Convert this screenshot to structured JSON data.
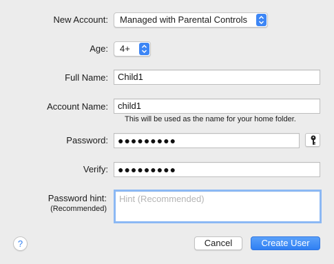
{
  "form": {
    "new_account": {
      "label": "New Account:",
      "value": "Managed with Parental Controls"
    },
    "age": {
      "label": "Age:",
      "value": "4+"
    },
    "full_name": {
      "label": "Full Name:",
      "value": "Child1"
    },
    "account_name": {
      "label": "Account Name:",
      "value": "child1",
      "note": "This will be used as the name for your home folder."
    },
    "password": {
      "label": "Password:",
      "value": "●●●●●●●●●"
    },
    "verify": {
      "label": "Verify:",
      "value": "●●●●●●●●●"
    },
    "password_hint": {
      "label": "Password hint:",
      "sublabel": "(Recommended)",
      "placeholder": "Hint (Recommended)"
    }
  },
  "buttons": {
    "help": "?",
    "cancel": "Cancel",
    "create": "Create User"
  },
  "icons": {
    "stepper": "updown-chevron-icon",
    "key": "key-icon",
    "help": "question-mark-icon"
  },
  "colors": {
    "accent": "#3d86f5",
    "background": "#ececec"
  }
}
